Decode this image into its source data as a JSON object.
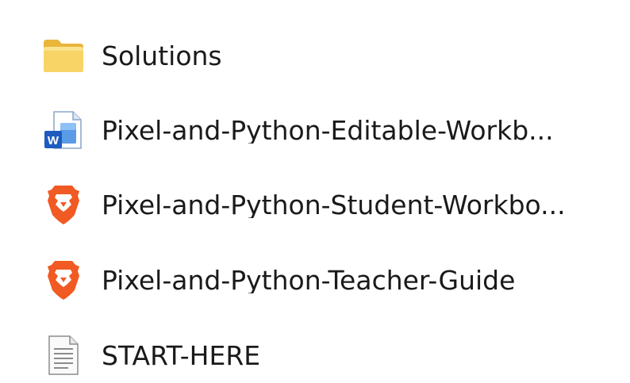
{
  "files": [
    {
      "name": "Solutions",
      "icon": "folder-icon"
    },
    {
      "name": "Pixel-and-Python-Editable-Workb...",
      "icon": "word-document-icon"
    },
    {
      "name": "Pixel-and-Python-Student-Workbo...",
      "icon": "brave-pdf-icon"
    },
    {
      "name": "Pixel-and-Python-Teacher-Guide",
      "icon": "brave-pdf-icon"
    },
    {
      "name": "START-HERE",
      "icon": "text-file-icon"
    }
  ],
  "colors": {
    "folder": "#f5c94a",
    "word_blue": "#2b6cd6",
    "brave_orange": "#f15a22"
  }
}
